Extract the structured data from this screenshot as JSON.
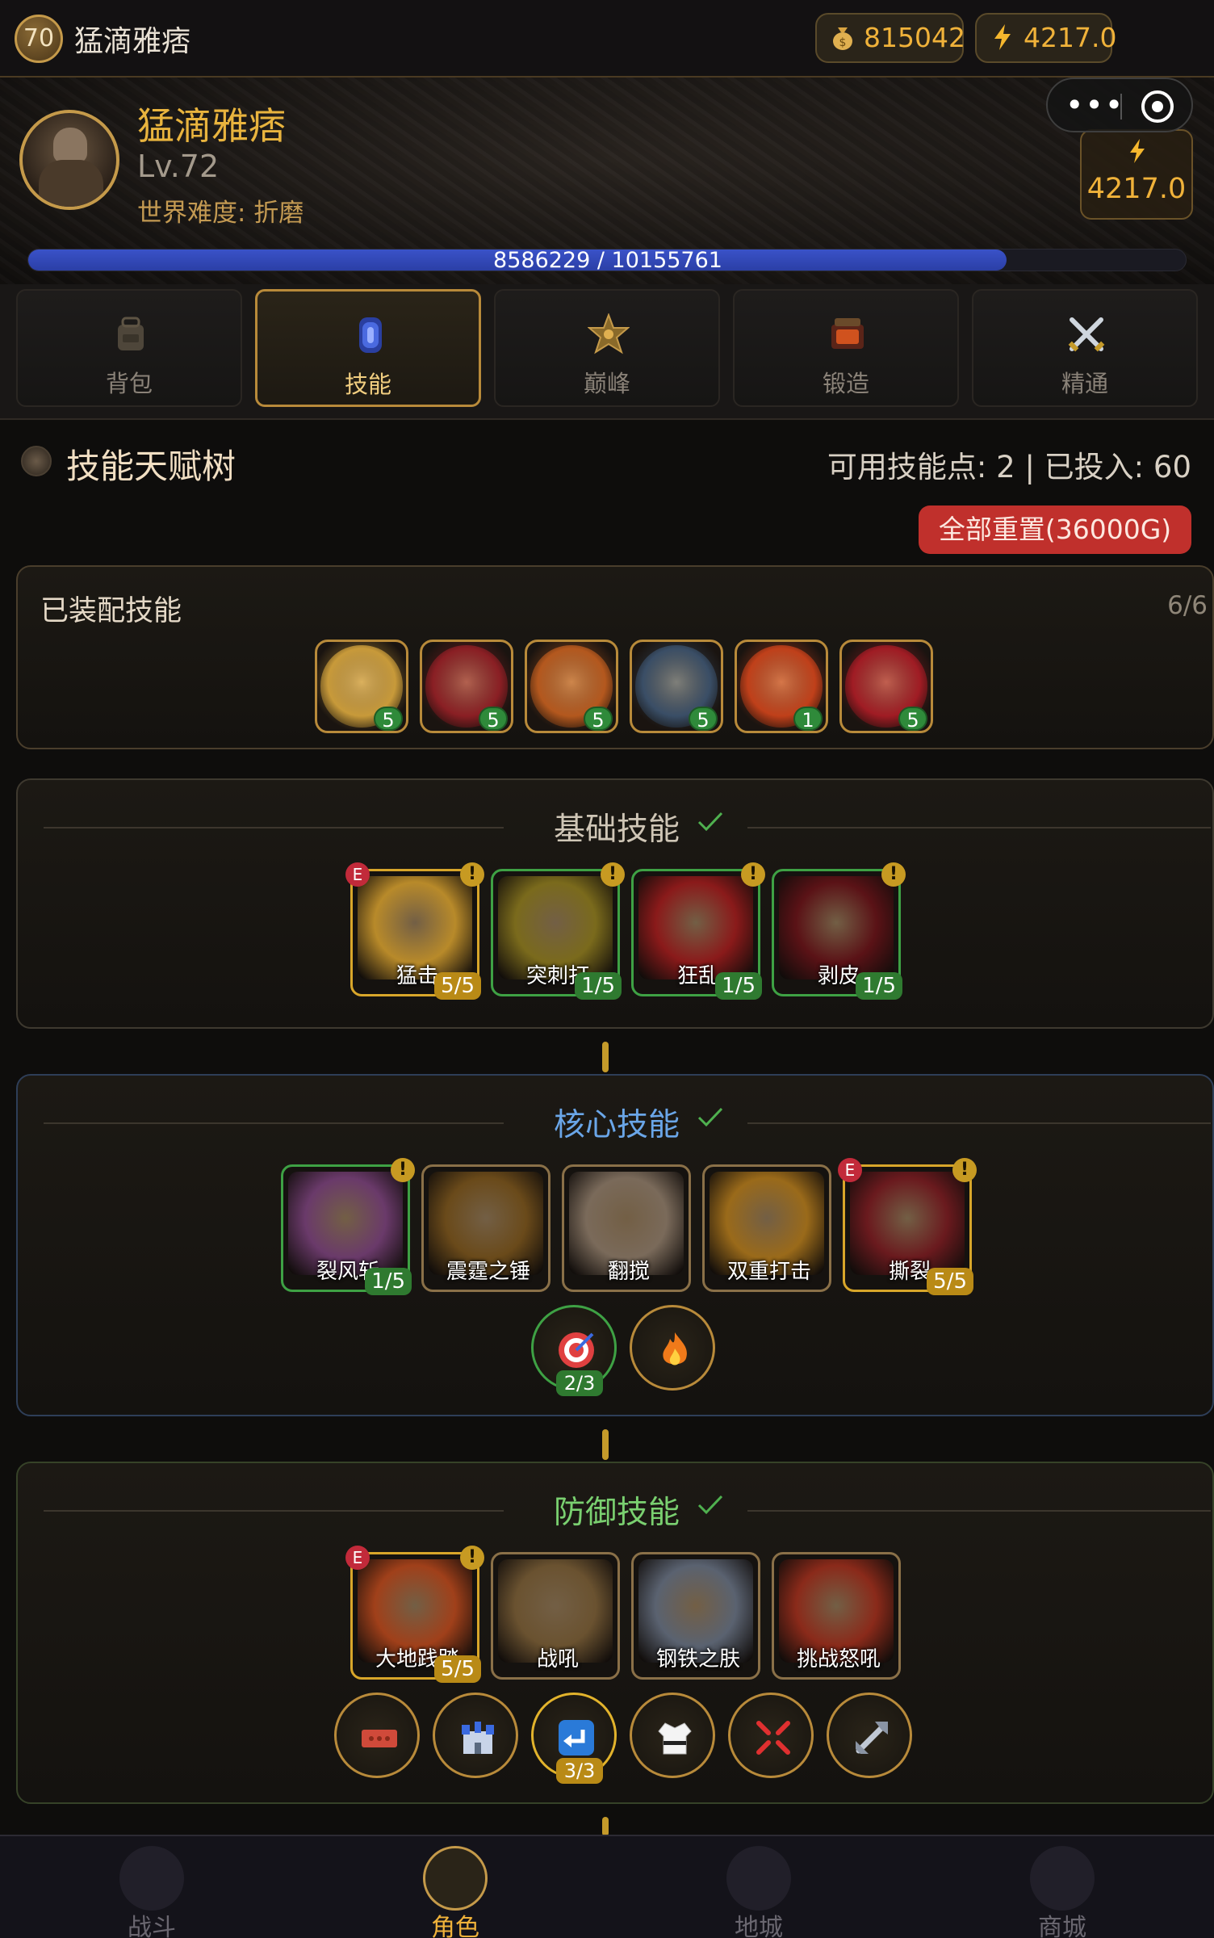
{
  "topbar": {
    "level": "70",
    "name": "猛滴雅痞",
    "gold": "815042",
    "energy": "4217.0"
  },
  "profile": {
    "name": "猛滴雅痞",
    "level": "Lv.72",
    "difficulty": "世界难度: 折磨",
    "energy": "4217.0",
    "xp_text": "8586229 / 10155761",
    "xp_current": 8586229,
    "xp_max": 10155761
  },
  "tabs": [
    {
      "label": "背包",
      "icon": "backpack-icon",
      "active": false
    },
    {
      "label": "技能",
      "icon": "skill-gem-icon",
      "active": true
    },
    {
      "label": "巅峰",
      "icon": "paragon-star-icon",
      "active": false
    },
    {
      "label": "锻造",
      "icon": "forge-icon",
      "active": false
    },
    {
      "label": "精通",
      "icon": "crossed-swords-icon",
      "active": false
    }
  ],
  "skill_tree": {
    "title": "技能天赋树",
    "stats": "可用技能点: 2 | 已投入: 60",
    "reset_label": "全部重置(36000G)"
  },
  "equipped": {
    "title": "已装配技能",
    "count": "6/6",
    "slots": [
      {
        "level": "5",
        "color": "#c89a3a"
      },
      {
        "level": "5",
        "color": "#8a1f24"
      },
      {
        "level": "5",
        "color": "#b4581e"
      },
      {
        "level": "5",
        "color": "#3a4e66"
      },
      {
        "level": "1",
        "color": "#c0401a"
      },
      {
        "level": "5",
        "color": "#a01c24"
      }
    ]
  },
  "basic": {
    "title": "基础技能",
    "color": "#c8c0b0",
    "skills": [
      {
        "name": "猛击",
        "level": "5/5",
        "style": "gold",
        "e": "E",
        "art": "#b88a2a"
      },
      {
        "name": "突刺打",
        "level": "1/5",
        "style": "green",
        "e": "",
        "art": "#7a6a1c"
      },
      {
        "name": "狂乱",
        "level": "1/5",
        "style": "green",
        "e": "",
        "art": "#8a1a1a"
      },
      {
        "name": "剥皮",
        "level": "1/5",
        "style": "green",
        "e": "",
        "art": "#5a1216"
      }
    ]
  },
  "core": {
    "title": "核心技能",
    "color": "#6aa6e8",
    "skills": [
      {
        "name": "裂风斩",
        "level": "1/5",
        "style": "green",
        "e": "",
        "art": "#6a3a6a"
      },
      {
        "name": "震霆之锤",
        "level": "",
        "style": "plain",
        "e": "",
        "art": "#6a4a1a"
      },
      {
        "name": "翻搅",
        "level": "",
        "style": "plain",
        "e": "",
        "art": "#7a6a5a"
      },
      {
        "name": "双重打击",
        "level": "",
        "style": "plain",
        "e": "",
        "art": "#9a6a1a"
      },
      {
        "name": "撕裂",
        "level": "5/5",
        "style": "gold",
        "e": "E",
        "art": "#6a1a1e"
      }
    ],
    "nodes": [
      {
        "icon": "target-icon",
        "level": "2/3",
        "style": "green"
      },
      {
        "icon": "fire-icon",
        "level": "",
        "style": "plain"
      }
    ]
  },
  "defense": {
    "title": "防御技能",
    "color": "#7ad070",
    "skills": [
      {
        "name": "大地践踏",
        "level": "5/5",
        "style": "gold",
        "e": "E",
        "art": "#a0401a"
      },
      {
        "name": "战吼",
        "level": "",
        "style": "plain",
        "e": "",
        "art": "#6a5230"
      },
      {
        "name": "钢铁之肤",
        "level": "",
        "style": "plain",
        "e": "",
        "art": "#5a6270"
      },
      {
        "name": "挑战怒吼",
        "level": "",
        "style": "plain",
        "e": "",
        "art": "#8a2a1a"
      }
    ],
    "nodes": [
      {
        "icon": "brick-icon",
        "level": "",
        "style": "plain"
      },
      {
        "icon": "castle-icon",
        "level": "",
        "style": "plain"
      },
      {
        "icon": "return-arrow-icon",
        "level": "3/3",
        "style": "gold"
      },
      {
        "icon": "martial-uniform-icon",
        "level": "",
        "style": "plain"
      },
      {
        "icon": "anger-icon",
        "level": "",
        "style": "plain"
      },
      {
        "icon": "bolt-nut-icon",
        "level": "",
        "style": "plain"
      }
    ]
  },
  "bottom_nav": [
    {
      "label": "战斗",
      "icon": "battle-icon",
      "active": false
    },
    {
      "label": "角色",
      "icon": "character-icon",
      "active": true
    },
    {
      "label": "地城",
      "icon": "dungeon-icon",
      "active": false
    },
    {
      "label": "商城",
      "icon": "shop-icon",
      "active": false
    }
  ],
  "colors": {
    "accent_gold": "#f0b23a",
    "xp_blue": "#3a52c8",
    "reset_red": "#c0302c",
    "green": "#3ea144"
  }
}
